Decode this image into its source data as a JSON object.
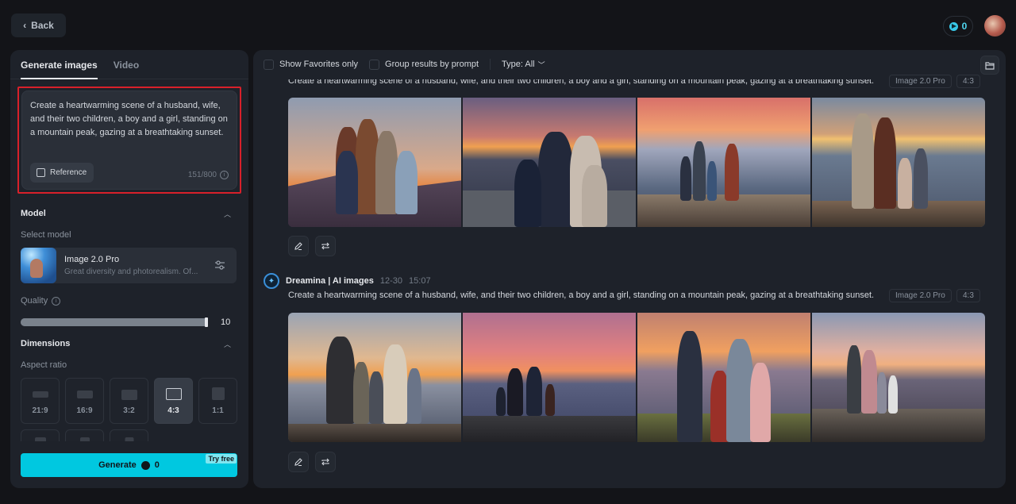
{
  "header": {
    "back_label": "Back",
    "credits": "0"
  },
  "left_panel": {
    "tabs": [
      {
        "label": "Generate images",
        "active": true
      },
      {
        "label": "Video",
        "active": false
      }
    ],
    "prompt": {
      "text": "Create a heartwarming scene of a husband, wife, and their two children, a boy and a girl, standing on a mountain peak, gazing at a breathtaking sunset.",
      "reference_label": "Reference",
      "char_count": "151/800"
    },
    "model_section": {
      "title": "Model",
      "select_label": "Select model",
      "model_name": "Image 2.0 Pro",
      "model_desc": "Great diversity and photorealism. Of..."
    },
    "quality": {
      "label": "Quality",
      "value": "10",
      "fraction": 1.0
    },
    "dimensions": {
      "title": "Dimensions",
      "aspect_label": "Aspect ratio",
      "ratios": [
        {
          "label": "21:9",
          "active": false
        },
        {
          "label": "16:9",
          "active": false
        },
        {
          "label": "3:2",
          "active": false
        },
        {
          "label": "4:3",
          "active": true
        },
        {
          "label": "1:1",
          "active": false
        },
        {
          "label": "",
          "active": false
        },
        {
          "label": "",
          "active": false
        },
        {
          "label": "",
          "active": false
        }
      ]
    },
    "generate": {
      "label": "Generate",
      "cost": "0",
      "badge": "Try free"
    }
  },
  "right_panel": {
    "toolbar": {
      "favorites_label": "Show Favorites only",
      "group_label": "Group results by prompt",
      "type_label": "Type: All"
    },
    "groups": [
      {
        "title": "",
        "date": "",
        "time": "",
        "prompt": "Create a heartwarming scene of a husband, wife, and their two children, a boy and a girl, standing on a mountain peak, gazing at a breathtaking sunset.",
        "model_tag": "Image 2.0 Pro",
        "ratio_tag": "4:3",
        "images": [
          {
            "alt": "family of four smiling together at sunset on a mountain"
          },
          {
            "alt": "family in hats and scarves embracing at sunset"
          },
          {
            "alt": "family seen from behind on rocky peak looking at mountains"
          },
          {
            "alt": "family with backpack watching the sun set over peaks"
          }
        ]
      },
      {
        "title": "Dreamina | AI images",
        "date": "12-30",
        "time": "15:07",
        "prompt": "Create a heartwarming scene of a husband, wife, and their two children, a boy and a girl, standing on a mountain peak, gazing at a breathtaking sunset.",
        "model_tag": "Image 2.0 Pro",
        "ratio_tag": "4:3",
        "images": [
          {
            "alt": "family from behind watching golden sunset"
          },
          {
            "alt": "silhouetted family holding hands under pink sky"
          },
          {
            "alt": "family posing facing camera on mountain at dusk"
          },
          {
            "alt": "family on rocky outcrop with flowers at sunset"
          }
        ]
      }
    ]
  },
  "colors": {
    "accent": "#00c8e0",
    "highlight_outline": "#d8202a",
    "panel_bg": "#1e222a",
    "page_bg": "#131418"
  }
}
